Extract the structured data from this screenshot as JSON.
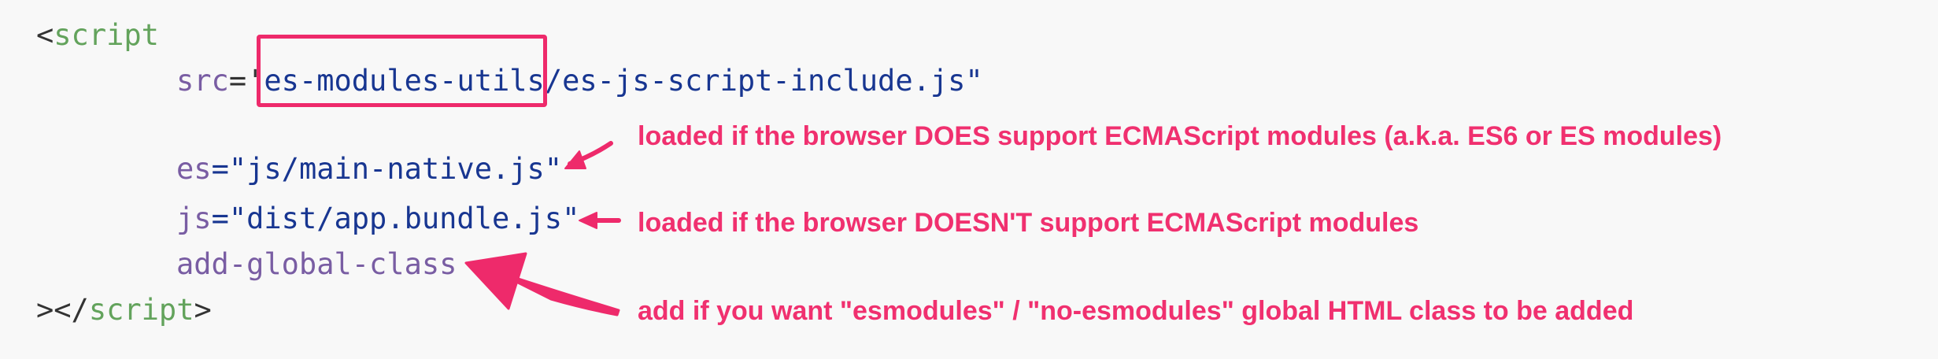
{
  "code": {
    "open_tag_lt": "<",
    "tag_name": "script",
    "src_attr": "src",
    "src_eq_quote": "='",
    "src_highlighted": "es-modules-utils",
    "src_rest": "/es-js-script-include.js\"",
    "es_attr": "es",
    "es_value": "=\"js/main-native.js\"",
    "js_attr": "js",
    "js_value": "=\"dist/app.bundle.js\"",
    "flag_attr": "add-global-class",
    "close_gt_lt": "></",
    "close_tag_name": "script",
    "close_gt": ">"
  },
  "annotations": {
    "es_note": "loaded if the browser DOES support ECMAScript modules (a.k.a. ES6 or ES modules)",
    "js_note": "loaded if the browser DOESN'T support ECMAScript modules",
    "flag_note": "add if you want \"esmodules\" / \"no-esmodules\" global HTML class to be added"
  },
  "colors": {
    "background": "#f8f8f8",
    "tag": "#63a35c",
    "attribute": "#795da3",
    "string": "#183691",
    "accent": "#ee2a6b"
  }
}
